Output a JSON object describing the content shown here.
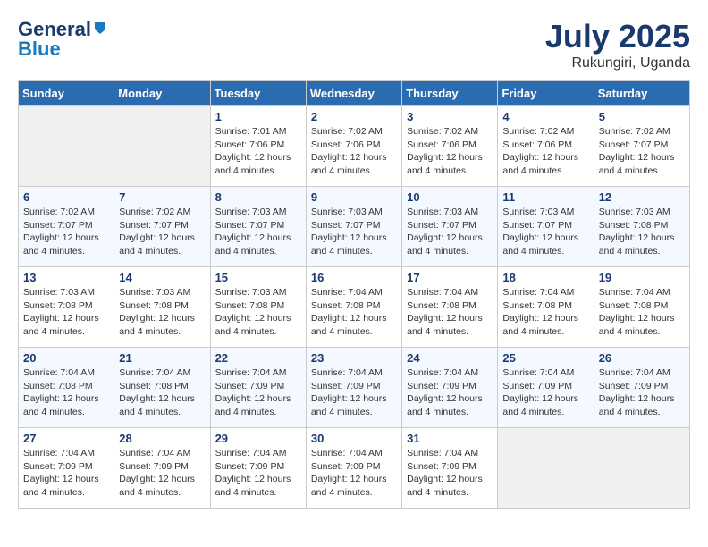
{
  "header": {
    "logo_general": "General",
    "logo_blue": "Blue",
    "month_year": "July 2025",
    "location": "Rukungiri, Uganda"
  },
  "weekdays": [
    "Sunday",
    "Monday",
    "Tuesday",
    "Wednesday",
    "Thursday",
    "Friday",
    "Saturday"
  ],
  "weeks": [
    [
      {
        "empty": true
      },
      {
        "empty": true
      },
      {
        "day": 1,
        "sunrise": "7:01 AM",
        "sunset": "7:06 PM",
        "daylight": "12 hours and 4 minutes."
      },
      {
        "day": 2,
        "sunrise": "7:02 AM",
        "sunset": "7:06 PM",
        "daylight": "12 hours and 4 minutes."
      },
      {
        "day": 3,
        "sunrise": "7:02 AM",
        "sunset": "7:06 PM",
        "daylight": "12 hours and 4 minutes."
      },
      {
        "day": 4,
        "sunrise": "7:02 AM",
        "sunset": "7:06 PM",
        "daylight": "12 hours and 4 minutes."
      },
      {
        "day": 5,
        "sunrise": "7:02 AM",
        "sunset": "7:07 PM",
        "daylight": "12 hours and 4 minutes."
      }
    ],
    [
      {
        "day": 6,
        "sunrise": "7:02 AM",
        "sunset": "7:07 PM",
        "daylight": "12 hours and 4 minutes."
      },
      {
        "day": 7,
        "sunrise": "7:02 AM",
        "sunset": "7:07 PM",
        "daylight": "12 hours and 4 minutes."
      },
      {
        "day": 8,
        "sunrise": "7:03 AM",
        "sunset": "7:07 PM",
        "daylight": "12 hours and 4 minutes."
      },
      {
        "day": 9,
        "sunrise": "7:03 AM",
        "sunset": "7:07 PM",
        "daylight": "12 hours and 4 minutes."
      },
      {
        "day": 10,
        "sunrise": "7:03 AM",
        "sunset": "7:07 PM",
        "daylight": "12 hours and 4 minutes."
      },
      {
        "day": 11,
        "sunrise": "7:03 AM",
        "sunset": "7:07 PM",
        "daylight": "12 hours and 4 minutes."
      },
      {
        "day": 12,
        "sunrise": "7:03 AM",
        "sunset": "7:08 PM",
        "daylight": "12 hours and 4 minutes."
      }
    ],
    [
      {
        "day": 13,
        "sunrise": "7:03 AM",
        "sunset": "7:08 PM",
        "daylight": "12 hours and 4 minutes."
      },
      {
        "day": 14,
        "sunrise": "7:03 AM",
        "sunset": "7:08 PM",
        "daylight": "12 hours and 4 minutes."
      },
      {
        "day": 15,
        "sunrise": "7:03 AM",
        "sunset": "7:08 PM",
        "daylight": "12 hours and 4 minutes."
      },
      {
        "day": 16,
        "sunrise": "7:04 AM",
        "sunset": "7:08 PM",
        "daylight": "12 hours and 4 minutes."
      },
      {
        "day": 17,
        "sunrise": "7:04 AM",
        "sunset": "7:08 PM",
        "daylight": "12 hours and 4 minutes."
      },
      {
        "day": 18,
        "sunrise": "7:04 AM",
        "sunset": "7:08 PM",
        "daylight": "12 hours and 4 minutes."
      },
      {
        "day": 19,
        "sunrise": "7:04 AM",
        "sunset": "7:08 PM",
        "daylight": "12 hours and 4 minutes."
      }
    ],
    [
      {
        "day": 20,
        "sunrise": "7:04 AM",
        "sunset": "7:08 PM",
        "daylight": "12 hours and 4 minutes."
      },
      {
        "day": 21,
        "sunrise": "7:04 AM",
        "sunset": "7:08 PM",
        "daylight": "12 hours and 4 minutes."
      },
      {
        "day": 22,
        "sunrise": "7:04 AM",
        "sunset": "7:09 PM",
        "daylight": "12 hours and 4 minutes."
      },
      {
        "day": 23,
        "sunrise": "7:04 AM",
        "sunset": "7:09 PM",
        "daylight": "12 hours and 4 minutes."
      },
      {
        "day": 24,
        "sunrise": "7:04 AM",
        "sunset": "7:09 PM",
        "daylight": "12 hours and 4 minutes."
      },
      {
        "day": 25,
        "sunrise": "7:04 AM",
        "sunset": "7:09 PM",
        "daylight": "12 hours and 4 minutes."
      },
      {
        "day": 26,
        "sunrise": "7:04 AM",
        "sunset": "7:09 PM",
        "daylight": "12 hours and 4 minutes."
      }
    ],
    [
      {
        "day": 27,
        "sunrise": "7:04 AM",
        "sunset": "7:09 PM",
        "daylight": "12 hours and 4 minutes."
      },
      {
        "day": 28,
        "sunrise": "7:04 AM",
        "sunset": "7:09 PM",
        "daylight": "12 hours and 4 minutes."
      },
      {
        "day": 29,
        "sunrise": "7:04 AM",
        "sunset": "7:09 PM",
        "daylight": "12 hours and 4 minutes."
      },
      {
        "day": 30,
        "sunrise": "7:04 AM",
        "sunset": "7:09 PM",
        "daylight": "12 hours and 4 minutes."
      },
      {
        "day": 31,
        "sunrise": "7:04 AM",
        "sunset": "7:09 PM",
        "daylight": "12 hours and 4 minutes."
      },
      {
        "empty": true
      },
      {
        "empty": true
      }
    ]
  ]
}
